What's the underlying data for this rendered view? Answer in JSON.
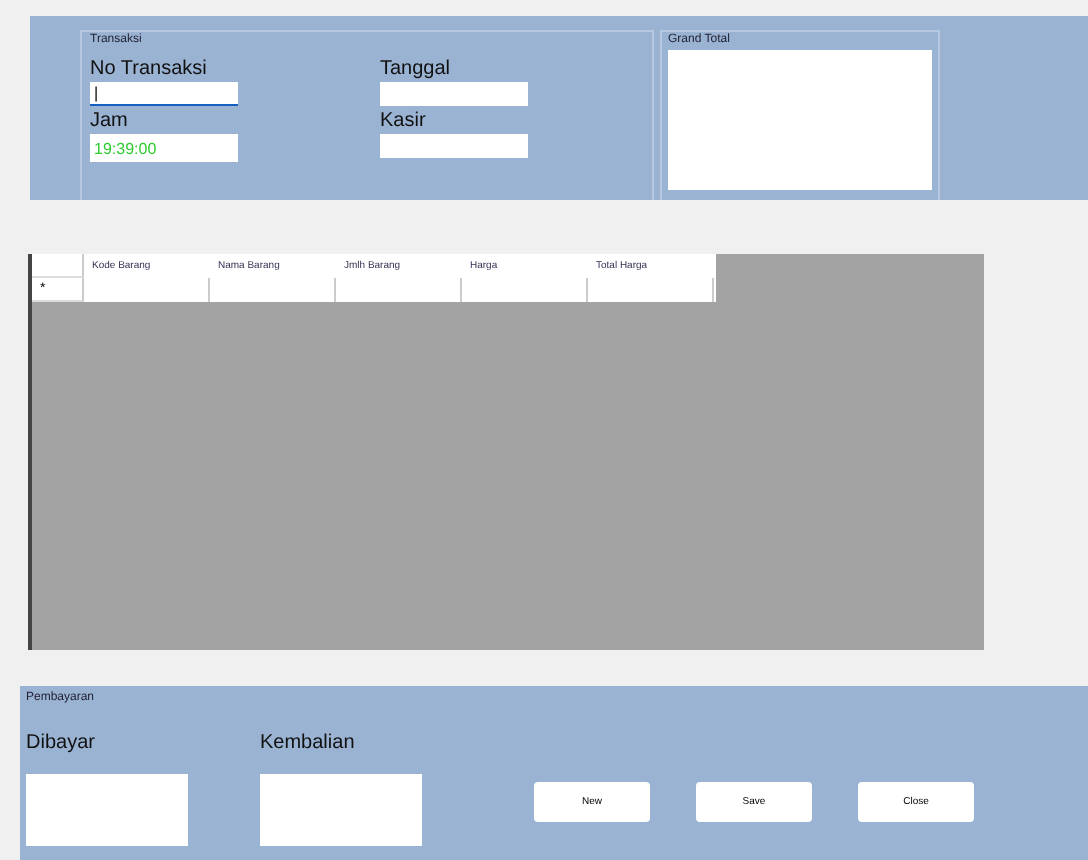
{
  "transaksi": {
    "title": "Transaksi",
    "fields": [
      {
        "label": "No Transaksi",
        "value": "|",
        "focused": true
      },
      {
        "label": "Tanggal",
        "focused": false
      },
      {
        "label": "Jam",
        "value": "19:39:00",
        "focused": false
      },
      {
        "label": "Kasir",
        "focused": false
      }
    ]
  },
  "grand_total": {
    "title": "Grand Total"
  },
  "table": {
    "columns": [
      "Kode Barang",
      "Nama Barang",
      "Jmlh Barang",
      "Harga",
      "Total Harga"
    ],
    "new_row_marker": "*"
  },
  "pembayaran": {
    "title": "Pembayaran",
    "fields": [
      {
        "label": "Dibayar"
      },
      {
        "label": "Kembalian"
      }
    ],
    "buttons": [
      "New",
      "Save",
      "Close"
    ]
  }
}
